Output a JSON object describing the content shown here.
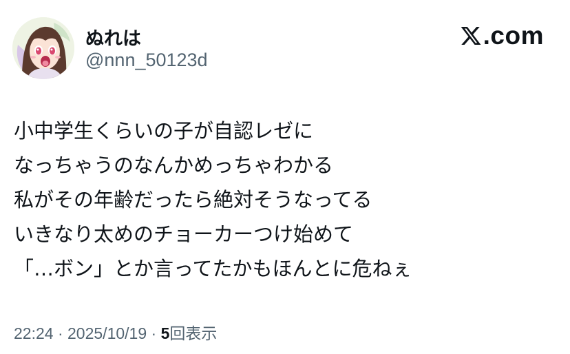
{
  "author": {
    "display_name": "ぬれは",
    "handle": "@nnn_50123d",
    "avatar_icon": "anime-girl-avatar-icon"
  },
  "brand": {
    "icon": "x-logo-icon",
    "text": ".com"
  },
  "tweet": {
    "lines": [
      "小中学生くらいの子が自認レゼに",
      "なっちゃうのなんかめっちゃわかる",
      "私がその年齢だったら絶対そうなってる",
      "いきなり太めのチョーカーつけ始めて",
      "「…ボン」とか言ってたかもほんとに危ねぇ"
    ]
  },
  "meta": {
    "time": "22:24",
    "separator": " · ",
    "date": "2025/10/19",
    "views_count": "5",
    "views_label": "回表示"
  },
  "colors": {
    "text_primary": "#0f1419",
    "text_secondary": "#536471",
    "background": "#ffffff"
  }
}
